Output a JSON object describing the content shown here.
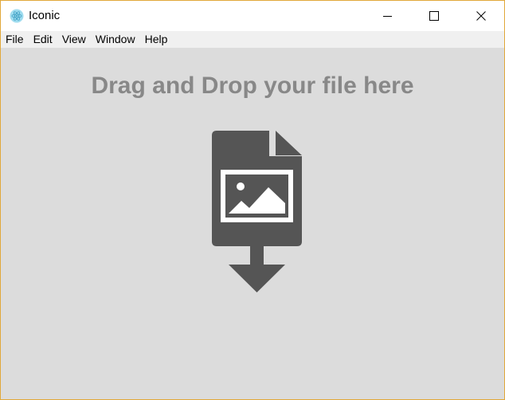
{
  "window": {
    "title": "Iconic",
    "icon": "atom-icon",
    "controls": [
      "minimize-icon",
      "maximize-icon",
      "close-icon"
    ]
  },
  "menu": {
    "items": [
      {
        "label": "File"
      },
      {
        "label": "Edit"
      },
      {
        "label": "View"
      },
      {
        "label": "Window"
      },
      {
        "label": "Help"
      }
    ]
  },
  "content": {
    "heading": "Drag and Drop your file here",
    "drop_icon": "image-file-download-icon"
  },
  "colors": {
    "background": "#dcdcdc",
    "heading": "#888888",
    "icon": "#555555",
    "window_border": "#e1a83a"
  }
}
